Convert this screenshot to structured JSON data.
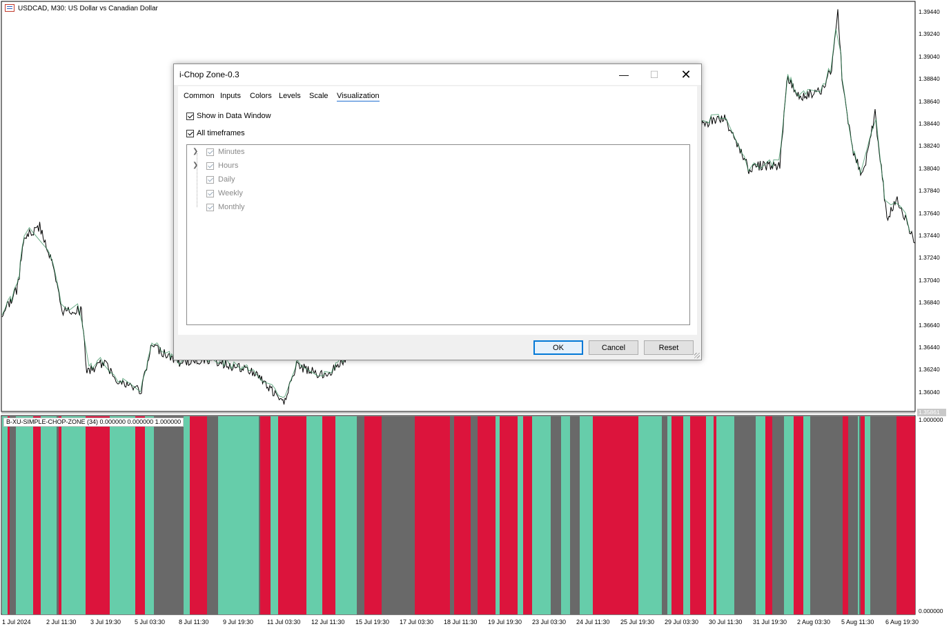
{
  "chart": {
    "symbol_title": "USDCAD, M30:  US Dollar vs Canadian Dollar",
    "indicator_label": "B-XU-SIMPLE-CHOP-ZONE (34) 0.000000 0.000000 1.000000",
    "current_price_label": "1.35861",
    "price_ticks": [
      "1.39440",
      "1.39240",
      "1.39040",
      "1.38840",
      "1.38640",
      "1.38440",
      "1.38240",
      "1.38040",
      "1.37840",
      "1.37640",
      "1.37440",
      "1.37240",
      "1.37040",
      "1.36840",
      "1.36640",
      "1.36440",
      "1.36240",
      "1.36040"
    ],
    "indicator_ticks": [
      "1.000000",
      "0.000000"
    ],
    "time_ticks": [
      "1 Jul 2024",
      "2 Jul 11:30",
      "3 Jul 19:30",
      "5 Jul 03:30",
      "8 Jul 11:30",
      "9 Jul 19:30",
      "11 Jul 03:30",
      "12 Jul 11:30",
      "15 Jul 19:30",
      "17 Jul 03:30",
      "18 Jul 11:30",
      "19 Jul 19:30",
      "23 Jul 03:30",
      "24 Jul 11:30",
      "25 Jul 19:30",
      "29 Jul 03:30",
      "30 Jul 11:30",
      "31 Jul 19:30",
      "2 Aug 03:30",
      "5 Aug 11:30",
      "6 Aug 19:30"
    ],
    "colors": {
      "bull": "#66cdaa",
      "bear": "#dc143c",
      "neutral": "#696969",
      "candle_up": "#2e8b57",
      "candle_down": "#000000"
    }
  },
  "dialog": {
    "title": "i-Chop Zone-0.3",
    "tabs": [
      "Common",
      "Inputs",
      "Colors",
      "Levels",
      "Scale",
      "Visualization"
    ],
    "active_tab": "Visualization",
    "show_in_data_window": "Show in Data Window",
    "all_timeframes": "All timeframes",
    "tree_items": [
      "Minutes",
      "Hours",
      "Daily",
      "Weekly",
      "Monthly"
    ],
    "buttons": {
      "ok": "OK",
      "cancel": "Cancel",
      "reset": "Reset"
    }
  }
}
